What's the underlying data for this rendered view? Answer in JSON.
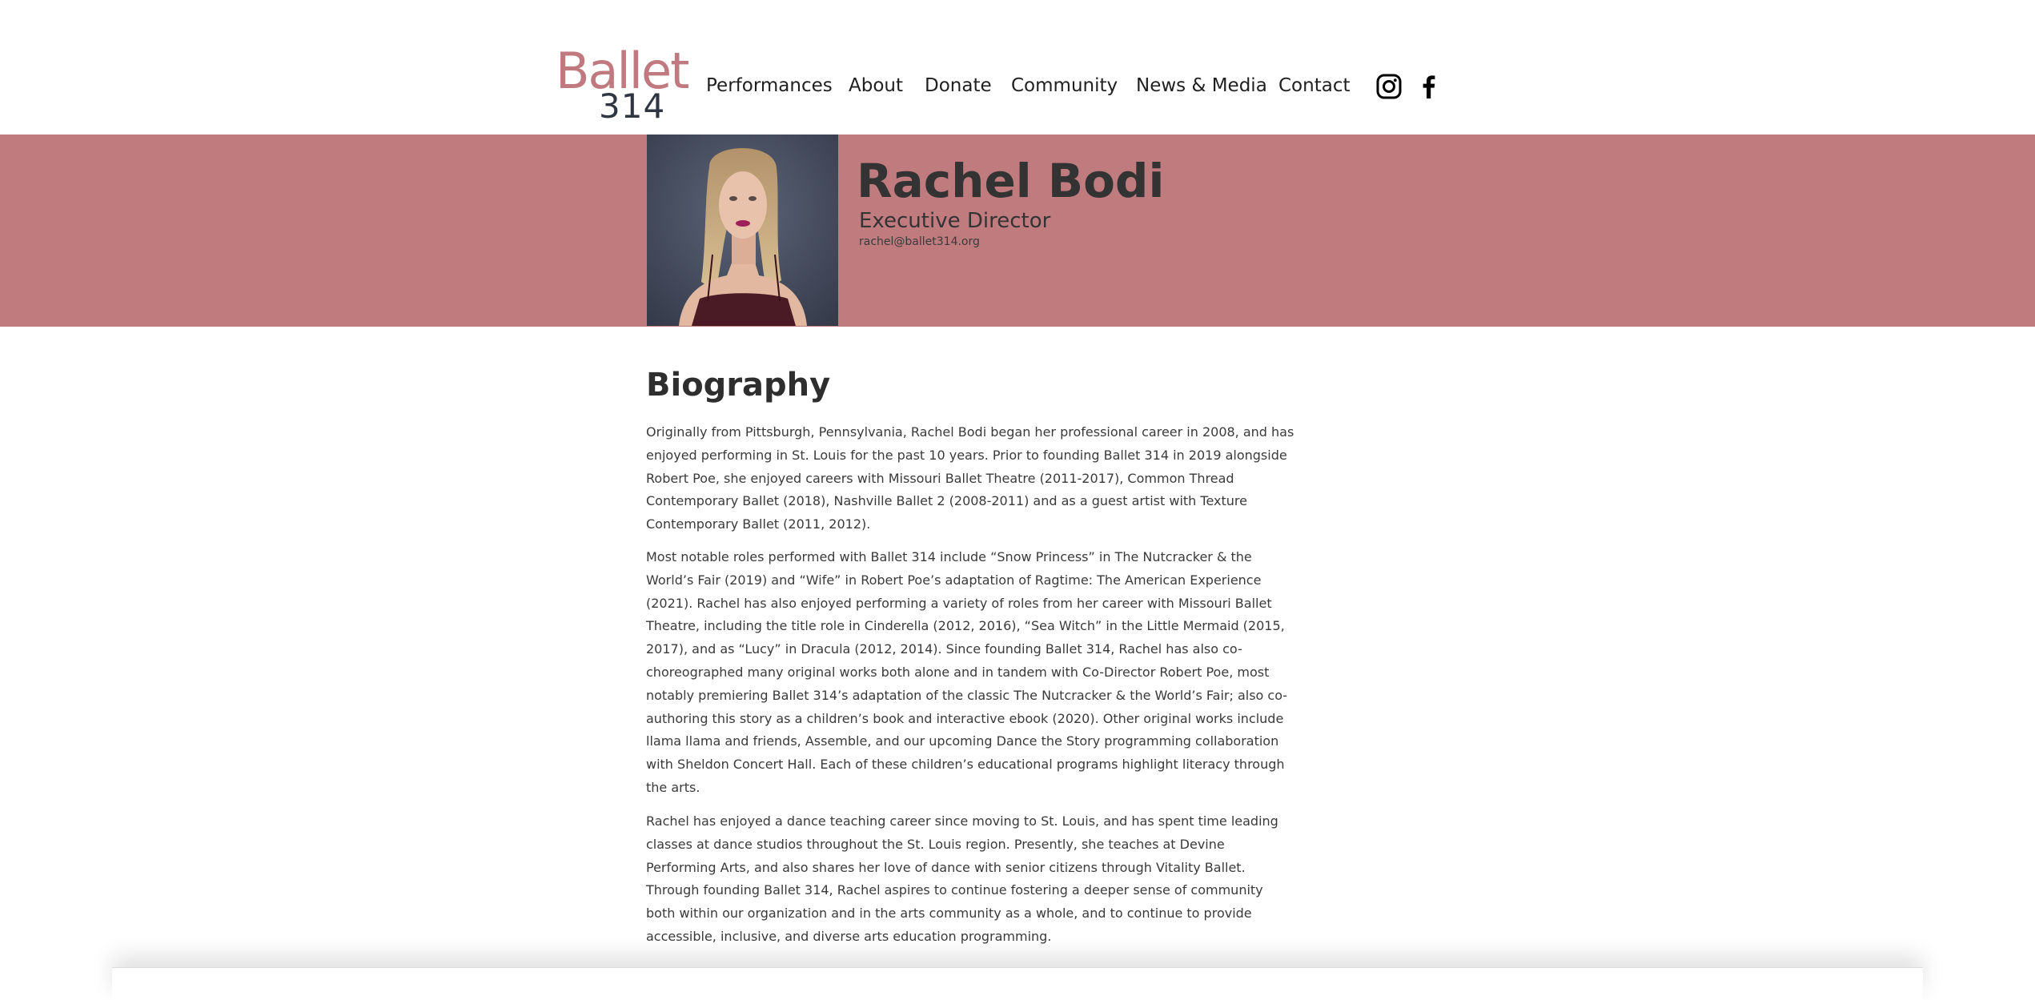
{
  "brand": {
    "logo_word": "Ballet",
    "logo_number": "314",
    "logo_color": "#c07a7f",
    "logo_number_color": "#2f3542"
  },
  "nav": {
    "items": [
      "Performances",
      "About",
      "Donate",
      "Community",
      "News & Media",
      "Contact"
    ],
    "social_icons": [
      "instagram-icon",
      "facebook-icon"
    ]
  },
  "profile": {
    "name": "Rachel Bodi",
    "title": "Executive Director",
    "email": "rachel@ballet314.org",
    "banner_color": "#c07b7f"
  },
  "biography": {
    "heading": "Biography",
    "paragraphs": [
      "Originally from Pittsburgh, Pennsylvania, Rachel Bodi began her professional career in 2008, and has enjoyed performing in St. Louis for the past 10 years. Prior to founding Ballet 314 in 2019 alongside Robert Poe, she enjoyed careers with Missouri Ballet Theatre (2011-2017), Common Thread Contemporary Ballet (2018), Nashville Ballet 2 (2008-2011) and as a guest artist with Texture Contemporary Ballet (2011, 2012).",
      "Most notable roles performed with Ballet 314 include “Snow Princess” in The Nutcracker & the World’s Fair (2019) and “Wife” in Robert Poe’s adaptation of Ragtime: The American Experience (2021). Rachel has also enjoyed performing a variety of roles from her career with Missouri Ballet Theatre, including the title role in Cinderella (2012, 2016), “Sea Witch” in the Little Mermaid (2015, 2017), and as “Lucy” in Dracula (2012, 2014). Since founding Ballet 314, Rachel has also co-choreographed many original works both alone and in tandem with Co-Director Robert Poe, most notably premiering Ballet 314’s adaptation of the classic The Nutcracker & the World’s Fair; also co-authoring this story as a children’s book and interactive ebook (2020). Other original works include llama llama and friends, Assemble, and our upcoming Dance the Story programming collaboration with Sheldon Concert Hall. Each of these children’s educational programs highlight literacy through the arts.",
      "Rachel has enjoyed a dance teaching career since moving to St. Louis, and has spent time leading classes at dance studios throughout the St. Louis region. Presently, she teaches at Devine Performing Arts, and also shares her love of dance with senior citizens through Vitality Ballet. Through founding Ballet 314, Rachel aspires to continue fostering a deeper sense of community both within our organization and in the arts community as a whole, and to continue to provide accessible, inclusive, and diverse arts education programming."
    ]
  }
}
